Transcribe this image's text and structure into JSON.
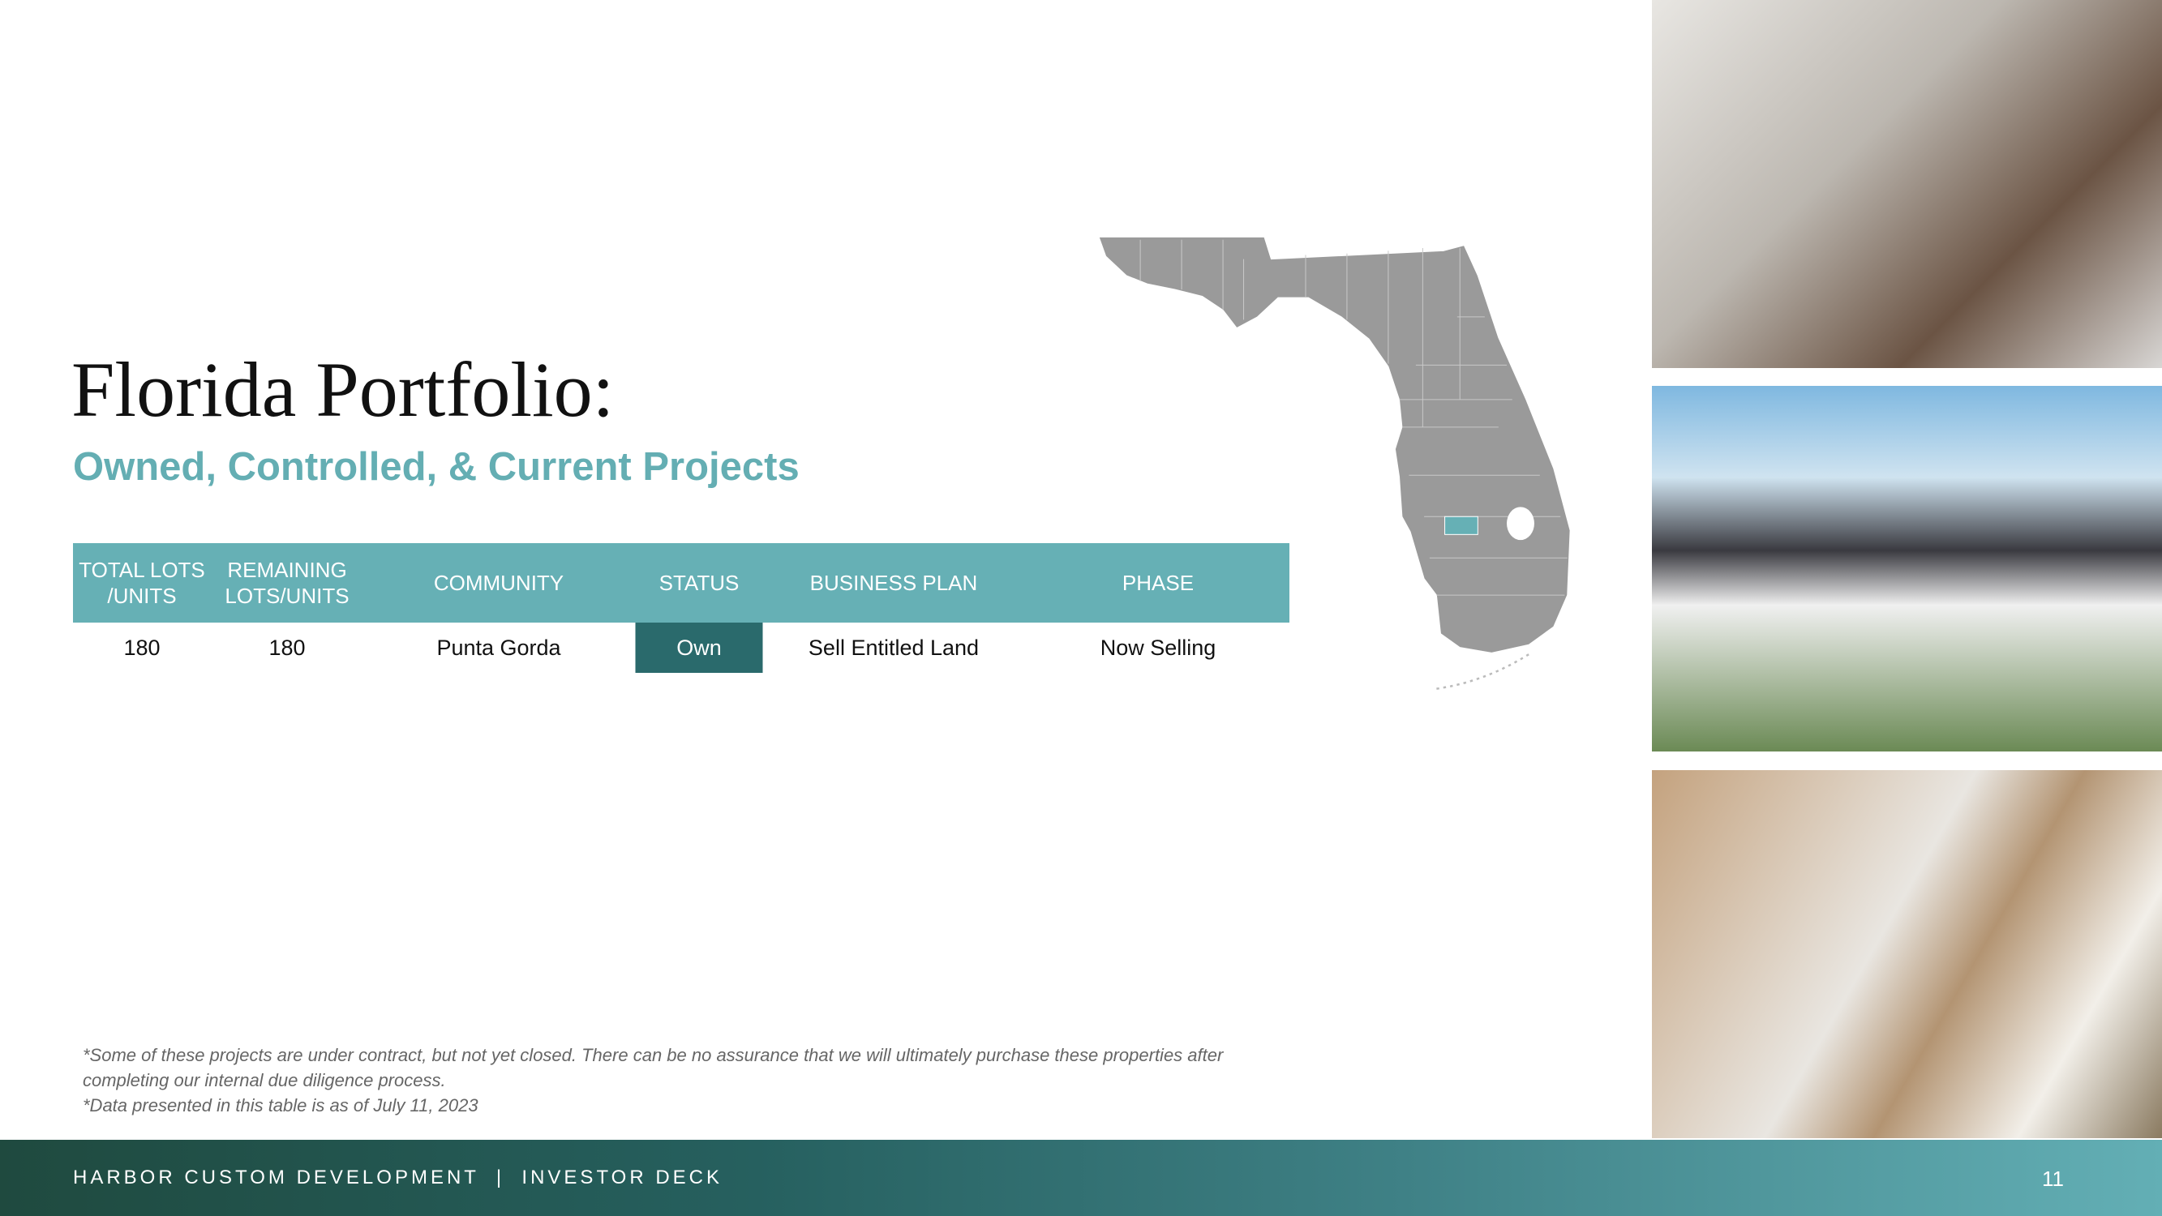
{
  "title": "Florida Portfolio:",
  "subtitle": "Owned, Controlled, & Current Projects",
  "table": {
    "headers": [
      "TOTAL LOTS /UNITS",
      "REMAINING LOTS/UNITS",
      "COMMUNITY",
      "STATUS",
      "BUSINESS PLAN",
      "PHASE"
    ],
    "rows": [
      [
        "180",
        "180",
        "Punta Gorda",
        "Own",
        "Sell Entitled Land",
        "Now Selling"
      ]
    ]
  },
  "notes": [
    "*Some of these projects are under contract, but not yet closed. There can be no assurance that we will ultimately purchase these properties after completing our internal due diligence process.",
    "*Data presented in this table is as of July 11, 2023"
  ],
  "footer": {
    "text": "HARBOR CUSTOM DEVELOPMENT  |  INVESTOR DECK",
    "page": "11"
  },
  "colors": {
    "accent": "#64aeb3",
    "status_fill": "#2a6a6c",
    "map_gray": "#9a9a9a",
    "highlight_county": "#66b0b5"
  },
  "photos": [
    "bathroom-photo",
    "house-exterior-photo",
    "kitchen-photo"
  ]
}
